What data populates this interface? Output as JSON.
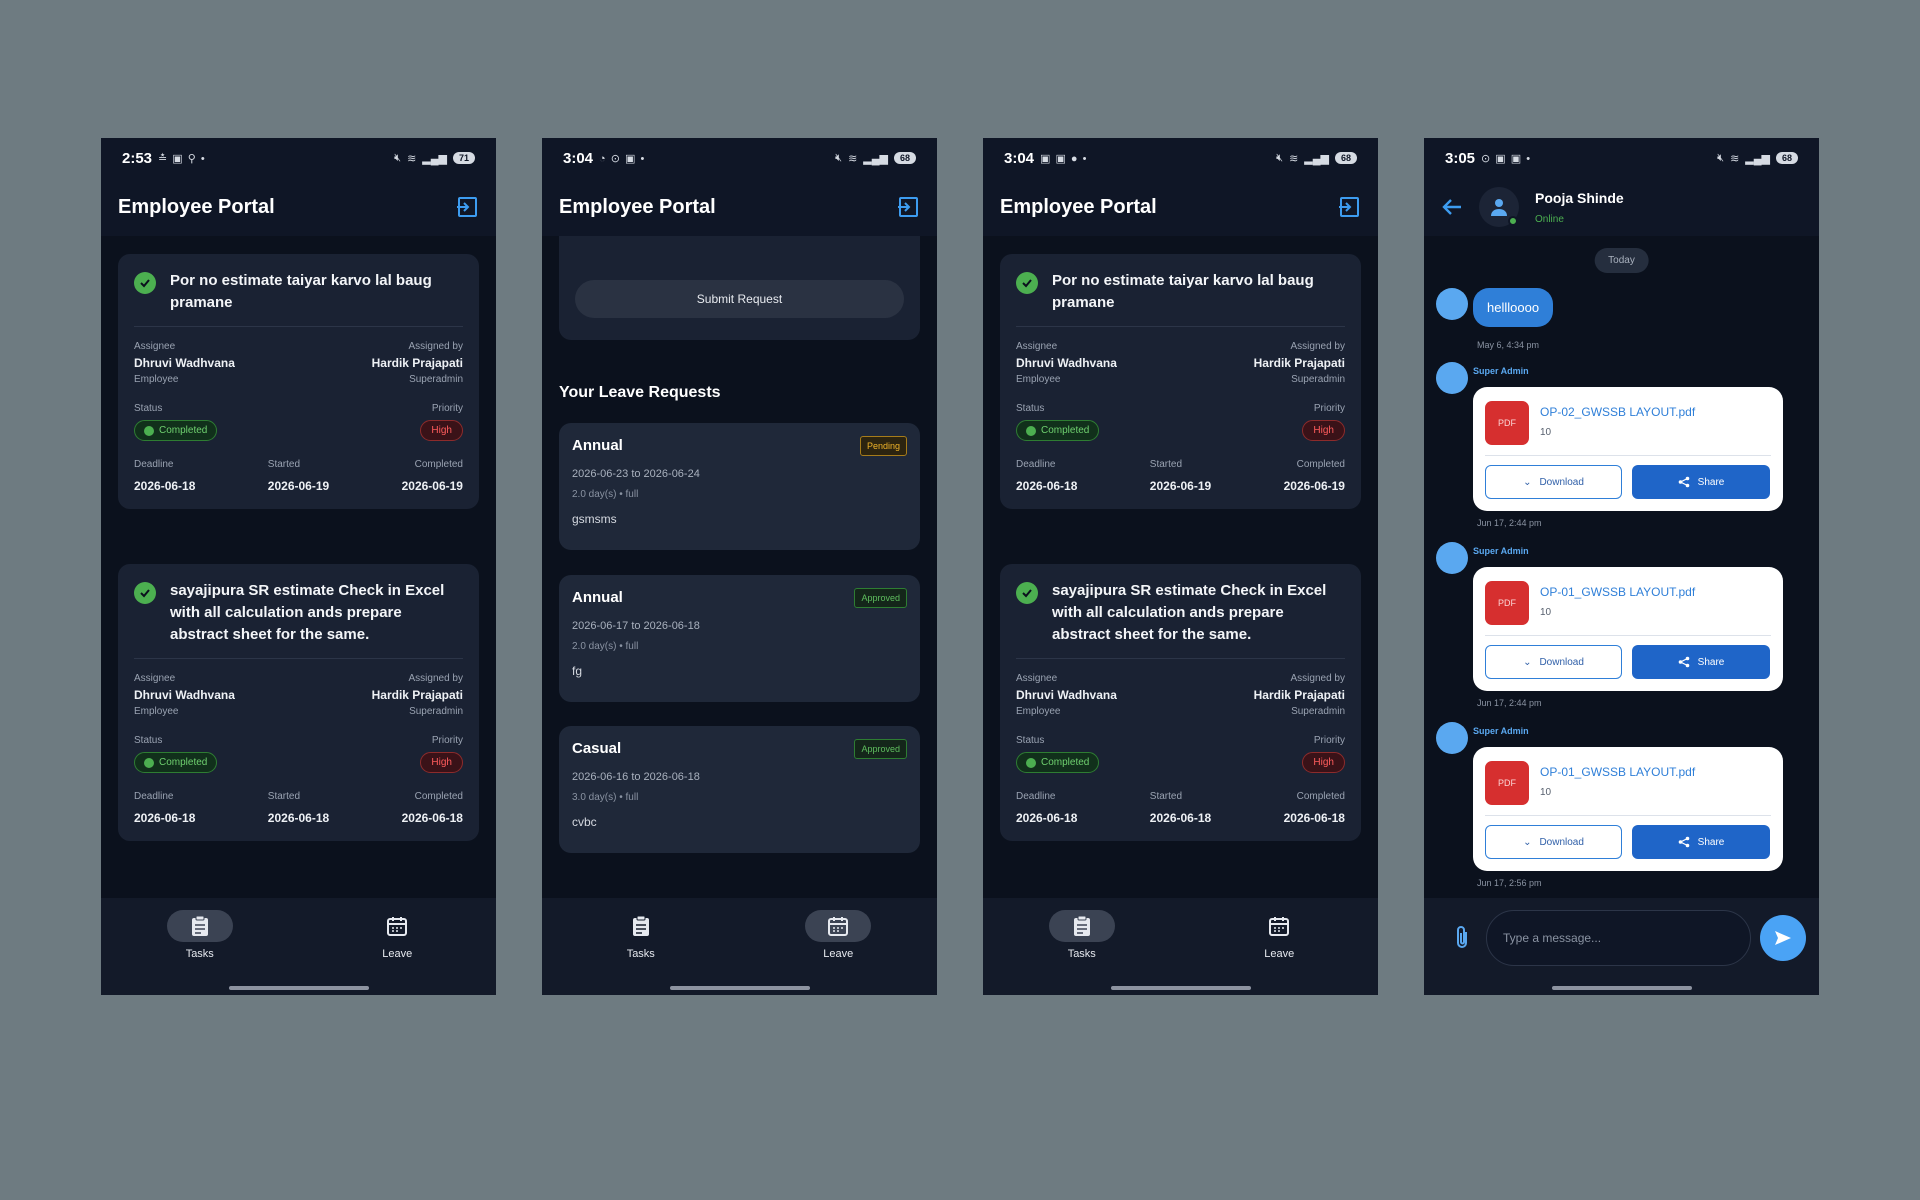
{
  "phone1": {
    "status": {
      "time": "2:53",
      "icons_left": "≛ ▣ ⚲ •",
      "battery": "71"
    },
    "header": {
      "title": "Employee Portal"
    },
    "tasks": [
      {
        "title": "Por no estimate taiyar karvo lal baug pramane",
        "assignee_label": "Assignee",
        "assignee": "Dhruvi Wadhvana",
        "assignee_role": "Employee",
        "assigned_by_label": "Assigned by",
        "assigned_by": "Hardik Prajapati",
        "assigned_by_role": "Superadmin",
        "status_label": "Status",
        "status": "Completed",
        "priority_label": "Priority",
        "priority": "High",
        "deadline_label": "Deadline",
        "deadline": "2026-06-18",
        "started_label": "Started",
        "started": "2026-06-19",
        "completed_label": "Completed",
        "completed": "2026-06-19"
      },
      {
        "title": "sayajipura SR estimate Check in Excel with all calculation ands prepare abstract sheet for the same.",
        "assignee_label": "Assignee",
        "assignee": "Dhruvi Wadhvana",
        "assignee_role": "Employee",
        "assigned_by_label": "Assigned by",
        "assigned_by": "Hardik Prajapati",
        "assigned_by_role": "Superadmin",
        "status_label": "Status",
        "status": "Completed",
        "priority_label": "Priority",
        "priority": "High",
        "deadline_label": "Deadline",
        "deadline": "2026-06-18",
        "started_label": "Started",
        "started": "2026-06-18",
        "completed_label": "Completed",
        "completed": "2026-06-18"
      }
    ],
    "nav": {
      "tasks": "Tasks",
      "leave": "Leave",
      "active": "Tasks"
    }
  },
  "phone2": {
    "status": {
      "time": "3:04",
      "icons_left": "◔ ⊙ ▣ •",
      "battery": "68"
    },
    "header": {
      "title": "Employee Portal"
    },
    "submit_label": "Submit Request",
    "section_title": "Your Leave Requests",
    "leaves": [
      {
        "type": "Annual",
        "badge": "Pending",
        "dates": "2026-06-23 to 2026-06-24",
        "days": "2.0 day(s) • full",
        "reason": "gsmsms"
      },
      {
        "type": "Annual",
        "badge": "Approved",
        "dates": "2026-06-17 to 2026-06-18",
        "days": "2.0 day(s) • full",
        "reason": "fg"
      },
      {
        "type": "Casual",
        "badge": "Approved",
        "dates": "2026-06-16 to 2026-06-18",
        "days": "3.0 day(s) • full",
        "reason": "cvbc"
      }
    ],
    "nav": {
      "tasks": "Tasks",
      "leave": "Leave",
      "active": "Leave"
    }
  },
  "phone3": {
    "status": {
      "time": "3:04",
      "icons_left": "▣ ▣ ● •",
      "battery": "68"
    },
    "header": {
      "title": "Employee Portal"
    },
    "tasks": [
      {
        "title": "Por no estimate taiyar karvo lal baug pramane",
        "assignee_label": "Assignee",
        "assignee": "Dhruvi Wadhvana",
        "assignee_role": "Employee",
        "assigned_by_label": "Assigned by",
        "assigned_by": "Hardik Prajapati",
        "assigned_by_role": "Superadmin",
        "status_label": "Status",
        "status": "Completed",
        "priority_label": "Priority",
        "priority": "High",
        "deadline_label": "Deadline",
        "deadline": "2026-06-18",
        "started_label": "Started",
        "started": "2026-06-19",
        "completed_label": "Completed",
        "completed": "2026-06-19"
      },
      {
        "title": "sayajipura SR estimate Check in Excel with all calculation ands prepare abstract sheet for the same.",
        "assignee_label": "Assignee",
        "assignee": "Dhruvi Wadhvana",
        "assignee_role": "Employee",
        "assigned_by_label": "Assigned by",
        "assigned_by": "Hardik Prajapati",
        "assigned_by_role": "Superadmin",
        "status_label": "Status",
        "status": "Completed",
        "priority_label": "Priority",
        "priority": "High",
        "deadline_label": "Deadline",
        "deadline": "2026-06-18",
        "started_label": "Started",
        "started": "2026-06-18",
        "completed_label": "Completed",
        "completed": "2026-06-18"
      }
    ],
    "nav": {
      "tasks": "Tasks",
      "leave": "Leave",
      "active": "Tasks"
    }
  },
  "phone4": {
    "status": {
      "time": "3:05",
      "icons_left": "⊙ ▣ ▣ •",
      "battery": "68"
    },
    "chat": {
      "name": "Pooja Shinde",
      "presence": "Online"
    },
    "today": "Today",
    "text_message": {
      "text": "hellloooo",
      "time": "May 6, 4:34 pm"
    },
    "files": [
      {
        "sender": "Super Admin",
        "name": "OP-02_GWSSB LAYOUT.pdf",
        "size": "10",
        "time": "Jun 17, 2:44 pm"
      },
      {
        "sender": "Super Admin",
        "name": "OP-01_GWSSB LAYOUT.pdf",
        "size": "10",
        "time": "Jun 17, 2:44 pm"
      },
      {
        "sender": "Super Admin",
        "name": "OP-01_GWSSB LAYOUT.pdf",
        "size": "10",
        "time": "Jun 17, 2:56 pm"
      }
    ],
    "pdf_label": "PDF",
    "download_label": "Download",
    "share_label": "Share",
    "input_placeholder": "Type a message..."
  },
  "colors": {
    "background": "#6e7b81",
    "phone_bg": "#0f1626",
    "card_bg": "#1a2233",
    "accent_blue": "#2f7fd8",
    "success_green": "#4caf50",
    "danger_red": "#ff5c5c",
    "pending_amber": "#f0b429"
  }
}
